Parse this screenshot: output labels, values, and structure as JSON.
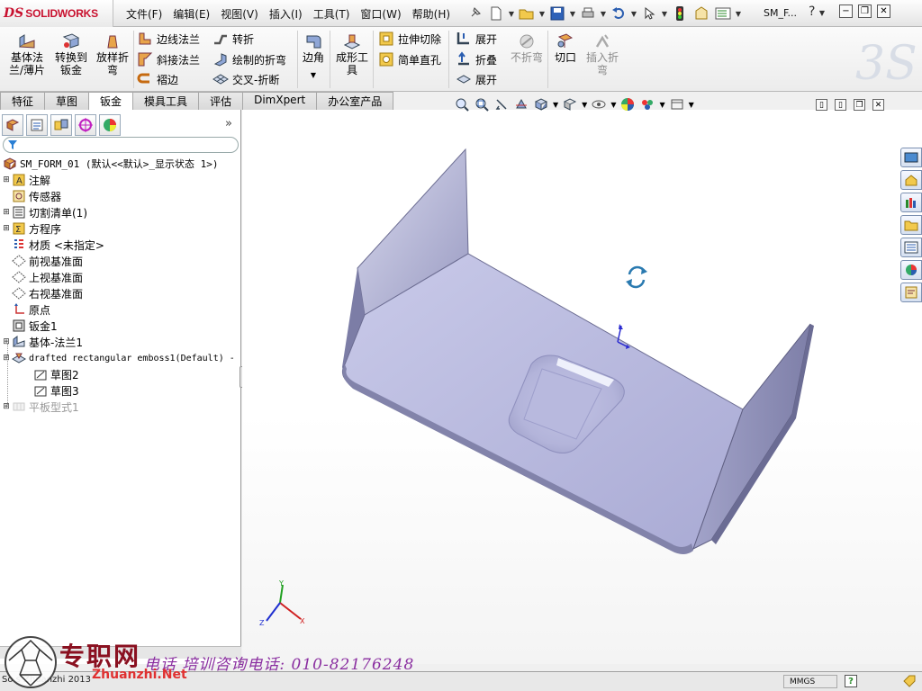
{
  "app": {
    "logo_ds": "DS",
    "logo_text": "SOLIDWORKS",
    "document_title": "SM_F...",
    "help_glyph": "?",
    "window_buttons": [
      "−",
      "❐",
      "✕"
    ]
  },
  "menu": [
    "文件(F)",
    "编辑(E)",
    "视图(V)",
    "插入(I)",
    "工具(T)",
    "窗口(W)",
    "帮助(H)"
  ],
  "ribbon": {
    "big_buttons": [
      {
        "label": "基体法\n兰/薄片",
        "icon": "base-flange-icon"
      },
      {
        "label": "转换到\n钣金",
        "icon": "convert-to-sheet-metal-icon"
      },
      {
        "label": "放样折\n弯",
        "icon": "lofted-bend-icon"
      }
    ],
    "col1": [
      {
        "label": "边线法兰",
        "icon": "edge-flange-icon"
      },
      {
        "label": "斜接法兰",
        "icon": "miter-flange-icon"
      },
      {
        "label": "褶边",
        "icon": "hem-icon"
      }
    ],
    "col2": [
      {
        "label": "转折",
        "icon": "jog-icon"
      },
      {
        "label": "绘制的折弯",
        "icon": "sketched-bend-icon"
      },
      {
        "label": "交叉-折断",
        "icon": "cross-break-icon"
      }
    ],
    "corner_label": "边角",
    "forming_tool_label": "成形工\n具",
    "col3": [
      {
        "label": "拉伸切除",
        "icon": "extruded-cut-icon"
      },
      {
        "label": "简单直孔",
        "icon": "simple-hole-icon"
      }
    ],
    "col4": [
      {
        "label": "展开",
        "icon": "unfold-icon"
      },
      {
        "label": "折叠",
        "icon": "fold-icon"
      },
      {
        "label": "展开",
        "icon": "flatten-icon"
      }
    ],
    "no_bends_label": "不折弯",
    "rip_label": "切口",
    "insert_bends_label": "插入折\n弯"
  },
  "tabs": [
    {
      "label": "特征",
      "active": false
    },
    {
      "label": "草图",
      "active": false
    },
    {
      "label": "钣金",
      "active": true
    },
    {
      "label": "模具工具",
      "active": false
    },
    {
      "label": "评估",
      "active": false
    },
    {
      "label": "DimXpert",
      "active": false
    },
    {
      "label": "办公室产品",
      "active": false
    }
  ],
  "tree": {
    "root": "SM_FORM_01  (默认<<默认>_显示状态 1>)",
    "items": [
      {
        "label": "注解",
        "icon": "annotations-icon",
        "expandable": true
      },
      {
        "label": "传感器",
        "icon": "sensors-icon",
        "expandable": false
      },
      {
        "label": "切割清单(1)",
        "icon": "cut-list-icon",
        "expandable": true
      },
      {
        "label": "方程序",
        "icon": "equations-icon",
        "expandable": true
      },
      {
        "label": "材质 <未指定>",
        "icon": "material-icon",
        "expandable": false
      },
      {
        "label": "前视基准面",
        "icon": "plane-icon",
        "expandable": false
      },
      {
        "label": "上视基准面",
        "icon": "plane-icon",
        "expandable": false
      },
      {
        "label": "右视基准面",
        "icon": "plane-icon",
        "expandable": false
      },
      {
        "label": "原点",
        "icon": "origin-icon",
        "expandable": false
      },
      {
        "label": "钣金1",
        "icon": "sheet-metal-icon",
        "expandable": false
      },
      {
        "label": "基体-法兰1",
        "icon": "base-flange-icon",
        "expandable": true
      },
      {
        "label": "drafted rectangular emboss1(Default) -",
        "icon": "form-tool-feature-icon",
        "expandable": true,
        "mono": true
      },
      {
        "label": "草图2",
        "icon": "sketch-icon",
        "expandable": false,
        "child": true
      },
      {
        "label": "草图3",
        "icon": "sketch-icon",
        "expandable": false,
        "child": true
      },
      {
        "label": "平板型式1",
        "icon": "flat-pattern-icon",
        "expandable": true,
        "greyed": true
      }
    ]
  },
  "status": {
    "left": "So  s  Zhuanzhi 2013",
    "units": "MMGS",
    "help": "?"
  },
  "watermark": {
    "brand": "专职网",
    "phone": "电话 培训咨询电话: 010-82176248",
    "url": "Zhuanzhi.Net"
  },
  "colors": {
    "part_face": "#c5c6e6",
    "part_edge": "#5f5f82",
    "accent_red": "#c8102e"
  }
}
